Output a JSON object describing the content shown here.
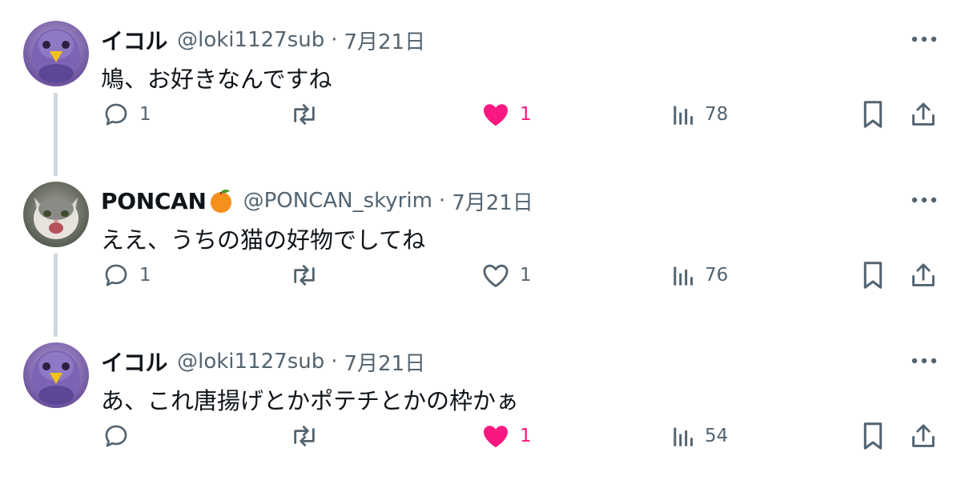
{
  "tweets": [
    {
      "name": "イコル",
      "handle": "@loki1127sub",
      "separator": "·",
      "date": "7月21日",
      "text": "鳩、お好きなんですね",
      "avatar": "budgie-avatar",
      "reply_count": "1",
      "like_count": "1",
      "liked": true,
      "view_count": "78"
    },
    {
      "name": "PONCAN",
      "name_emoji": "orange-emoji",
      "handle": "@PONCAN_skyrim",
      "separator": "·",
      "date": "7月21日",
      "text": "ええ、うちの猫の好物でしてね",
      "avatar": "cat-avatar",
      "reply_count": "1",
      "like_count": "1",
      "liked": false,
      "view_count": "76"
    },
    {
      "name": "イコル",
      "handle": "@loki1127sub",
      "separator": "·",
      "date": "7月21日",
      "text": "あ、これ唐揚げとかポテチとかの枠かぁ",
      "avatar": "budgie-avatar",
      "reply_count": "",
      "like_count": "1",
      "liked": true,
      "view_count": "54"
    }
  ],
  "colors": {
    "text": "#0f1419",
    "secondary": "#536471",
    "like": "#f91880",
    "thread_line": "#cfd9de"
  }
}
